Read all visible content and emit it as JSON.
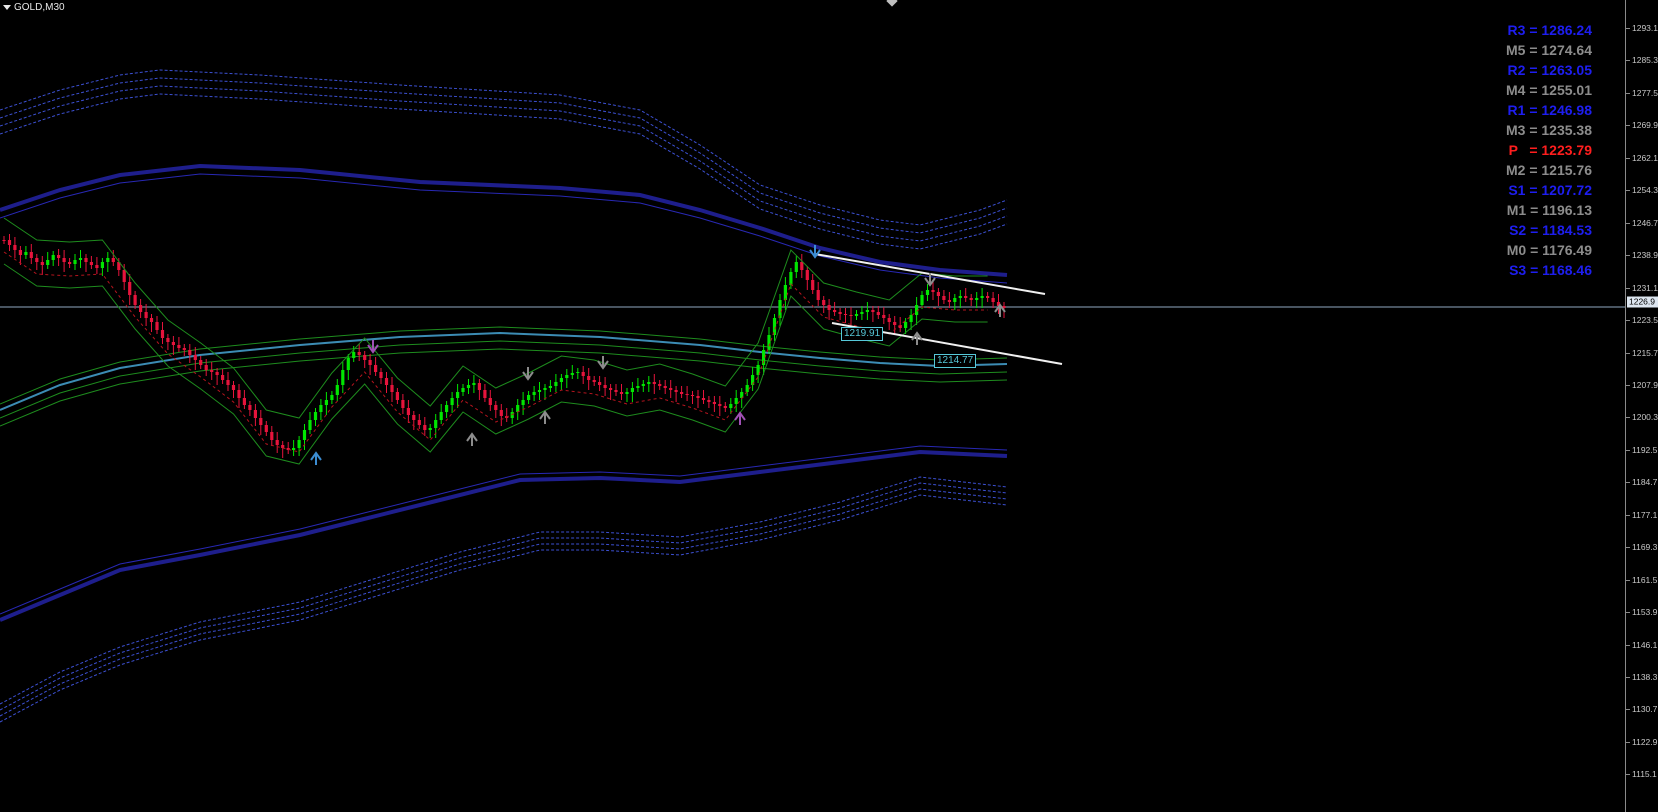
{
  "chart": {
    "symbol_label": "GOLD,M30",
    "current_price": "1226.9"
  },
  "price_axis": {
    "ticks": [
      "1293.1",
      "1285.3",
      "1277.5",
      "1269.9",
      "1262.1",
      "1254.3",
      "1246.7",
      "1238.9",
      "1231.1",
      "1223.5",
      "1215.7",
      "1207.9",
      "1200.3",
      "1192.5",
      "1184.7",
      "1177.1",
      "1169.3",
      "1161.5",
      "1153.9",
      "1146.1",
      "1138.3",
      "1130.7",
      "1122.9",
      "1115.1"
    ]
  },
  "pivot_levels": [
    {
      "text": "R3 = 1286.24",
      "color": "#1e1ef0"
    },
    {
      "text": "M5 = 1274.64",
      "color": "#8c8c8c"
    },
    {
      "text": "R2 = 1263.05",
      "color": "#1e1ef0"
    },
    {
      "text": "M4 = 1255.01",
      "color": "#8c8c8c"
    },
    {
      "text": "R1 = 1246.98",
      "color": "#1e1ef0"
    },
    {
      "text": "M3 = 1235.38",
      "color": "#8c8c8c"
    },
    {
      "text": "P   = 1223.79",
      "color": "#ff1e1e"
    },
    {
      "text": "M2 = 1215.76",
      "color": "#8c8c8c"
    },
    {
      "text": "S1 = 1207.72",
      "color": "#1e1ef0"
    },
    {
      "text": "M1 = 1196.13",
      "color": "#8c8c8c"
    },
    {
      "text": "S2 = 1184.53",
      "color": "#1e1ef0"
    },
    {
      "text": "M0 = 1176.49",
      "color": "#8c8c8c"
    },
    {
      "text": "S3 = 1168.46",
      "color": "#1e1ef0"
    }
  ],
  "annotations": {
    "label_upper": "1219.91",
    "label_lower": "1214.77"
  },
  "colors": {
    "bull_candle": "#00e600",
    "bear_candle": "#e6143c",
    "band_blue": "#1e1e8c",
    "band_teal": "#3c8cb4",
    "band_green": "#1e8c1e",
    "trendline": "#f0f0f0"
  }
}
